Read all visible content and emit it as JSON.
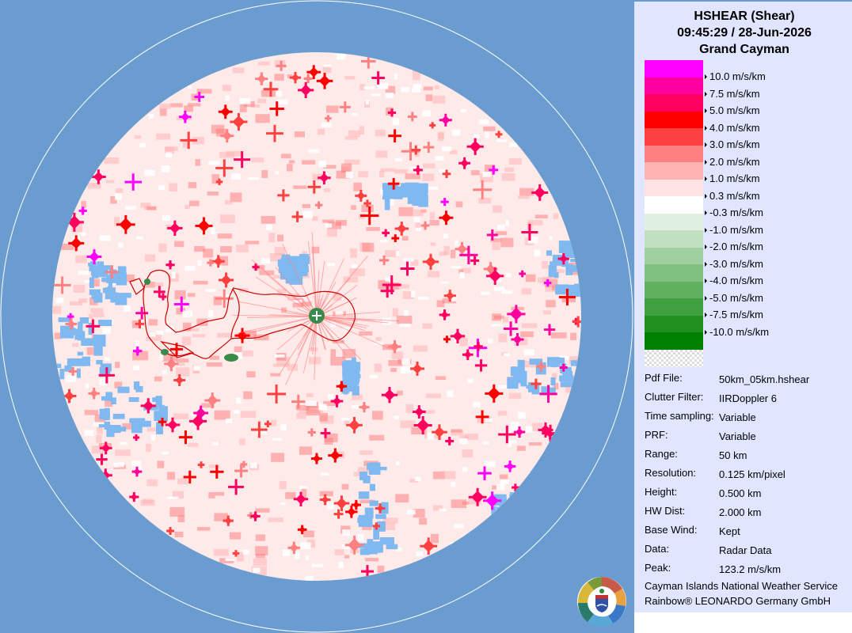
{
  "header": {
    "product": "HSHEAR (Shear)",
    "timestamp": "09:45:29 / 28-Jun-2026",
    "site": "Grand Cayman"
  },
  "legend": {
    "entries": [
      {
        "label": "10.0 m/s/km",
        "color": "#ff00ff"
      },
      {
        "label": "7.5 m/s/km",
        "color": "#ff00a0"
      },
      {
        "label": "5.0 m/s/km",
        "color": "#ff0060"
      },
      {
        "label": "4.0 m/s/km",
        "color": "#ff0000"
      },
      {
        "label": "3.0 m/s/km",
        "color": "#ff4040"
      },
      {
        "label": "2.0 m/s/km",
        "color": "#ff8080"
      },
      {
        "label": "1.0 m/s/km",
        "color": "#ffb4b4"
      },
      {
        "label": "0.3 m/s/km",
        "color": "#ffe4e4"
      },
      {
        "label": "-0.3 m/s/km",
        "color": "#ffffff"
      },
      {
        "label": "-1.0 m/s/km",
        "color": "#e0f0e0"
      },
      {
        "label": "-2.0 m/s/km",
        "color": "#c0e0c0"
      },
      {
        "label": "-3.0 m/s/km",
        "color": "#a0d0a0"
      },
      {
        "label": "-4.0 m/s/km",
        "color": "#80c080"
      },
      {
        "label": "-5.0 m/s/km",
        "color": "#60b060"
      },
      {
        "label": "-7.5 m/s/km",
        "color": "#40a040"
      },
      {
        "label": "-10.0 m/s/km",
        "color": "#209020"
      }
    ],
    "bottom_color": "#008000"
  },
  "info": [
    {
      "key": "Pdf File:",
      "value": "50km_05km.hshear"
    },
    {
      "key": "Clutter Filter:",
      "value": "IIRDoppler 6"
    },
    {
      "key": "Time sampling:",
      "value": "Variable"
    },
    {
      "key": "PRF:",
      "value": "Variable"
    },
    {
      "key": "Range:",
      "value": "50 km"
    },
    {
      "key": "Resolution:",
      "value": "0.125 km/pixel"
    },
    {
      "key": "Height:",
      "value": "0.500 km"
    },
    {
      "key": "HW Dist:",
      "value": "2.000 km"
    },
    {
      "key": "Base Wind:",
      "value": "Kept"
    },
    {
      "key": "Data:",
      "value": "Radar Data"
    },
    {
      "key": "Peak:",
      "value": "123.2 m/s/km"
    }
  ],
  "footer": {
    "agency": "Cayman Islands National Weather Service",
    "vendor": "Rainbow® LEONARDO Germany GmbH"
  },
  "colors": {
    "background": "#6a9ccf",
    "panel": "#e0e6ff",
    "no_data": "#80b8f0",
    "coastline": "#cc0000",
    "radar_site": "#3a8a4a"
  },
  "icons": {
    "radar_site": "plus-circle-icon",
    "logo": "cayman-crest-logo"
  }
}
